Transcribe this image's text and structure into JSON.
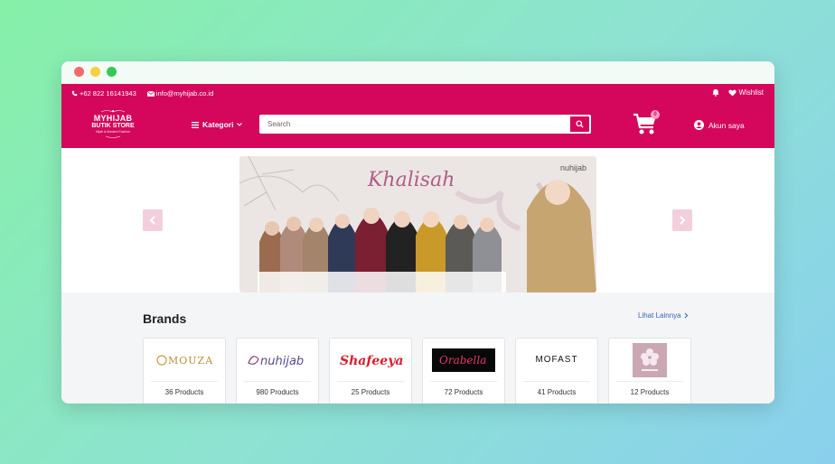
{
  "topbar": {
    "phone": "+62 822 16141943",
    "email": "info@myhijab.co.id",
    "wishlist": "Wishlist"
  },
  "logo": {
    "line1": "MYHIJAB",
    "line2": "BUTIK STORE",
    "tagline": "Hijab & Moslem Fashion"
  },
  "nav": {
    "kategori": "Kategori"
  },
  "search": {
    "placeholder": "Search"
  },
  "cart": {
    "count": "0"
  },
  "account": {
    "label": "Akun saya"
  },
  "banner": {
    "brand_script": "Khalisah",
    "brand_mark": "nuhijab"
  },
  "brands": {
    "title": "Brands",
    "more_link": "Lihat Lainnya",
    "items": [
      {
        "name": "MOUZA",
        "count": "36 Products"
      },
      {
        "name": "nuhijab",
        "count": "980 Products"
      },
      {
        "name": "Shafeeya",
        "count": "25 Products"
      },
      {
        "name": "Orabella",
        "count": "72 Products"
      },
      {
        "name": "MOFAST",
        "count": "41 Products"
      },
      {
        "name": "flower-logo",
        "count": "12 Products"
      }
    ]
  },
  "colors": {
    "brand_pink": "#d4075c",
    "link_blue": "#3d62b8",
    "section_bg": "#f4f5f7"
  },
  "icons": [
    "phone-icon",
    "mail-icon",
    "bell-icon",
    "heart-icon",
    "menu-icon",
    "chevron-down-icon",
    "search-icon",
    "cart-icon",
    "user-icon",
    "chevron-left-icon",
    "chevron-right-icon",
    "chevron-right-small-icon"
  ]
}
